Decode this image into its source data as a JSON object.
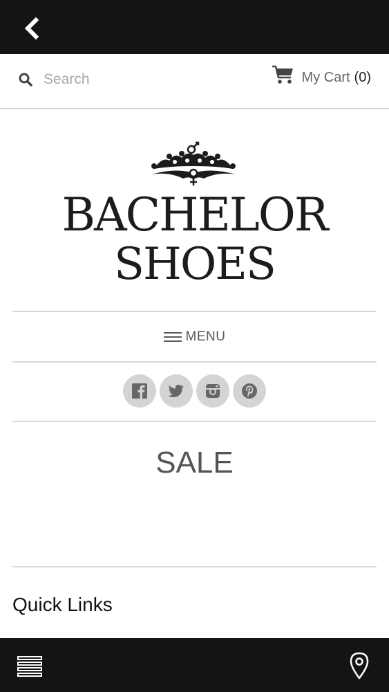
{
  "topbar": {
    "back_icon": "chevron-left-icon"
  },
  "header": {
    "search_placeholder": "Search",
    "search_value": "",
    "cart_label": "My Cart",
    "cart_count": "(0)"
  },
  "logo": {
    "line1": "BACHELOR",
    "line2": "SHOES",
    "emblem": "crown-icon"
  },
  "menu": {
    "label": "MENU"
  },
  "social": [
    "facebook-icon",
    "twitter-icon",
    "instagram-icon",
    "pinterest-icon"
  ],
  "sale": {
    "title": "SALE"
  },
  "quick_links": {
    "title": "Quick Links"
  },
  "bottombar": {
    "left_icon": "hamburger-icon",
    "right_icon": "location-pin-icon"
  },
  "colors": {
    "bar": "#141414",
    "divider": "#d9d9d9",
    "social_bg": "#d4d4d4"
  }
}
